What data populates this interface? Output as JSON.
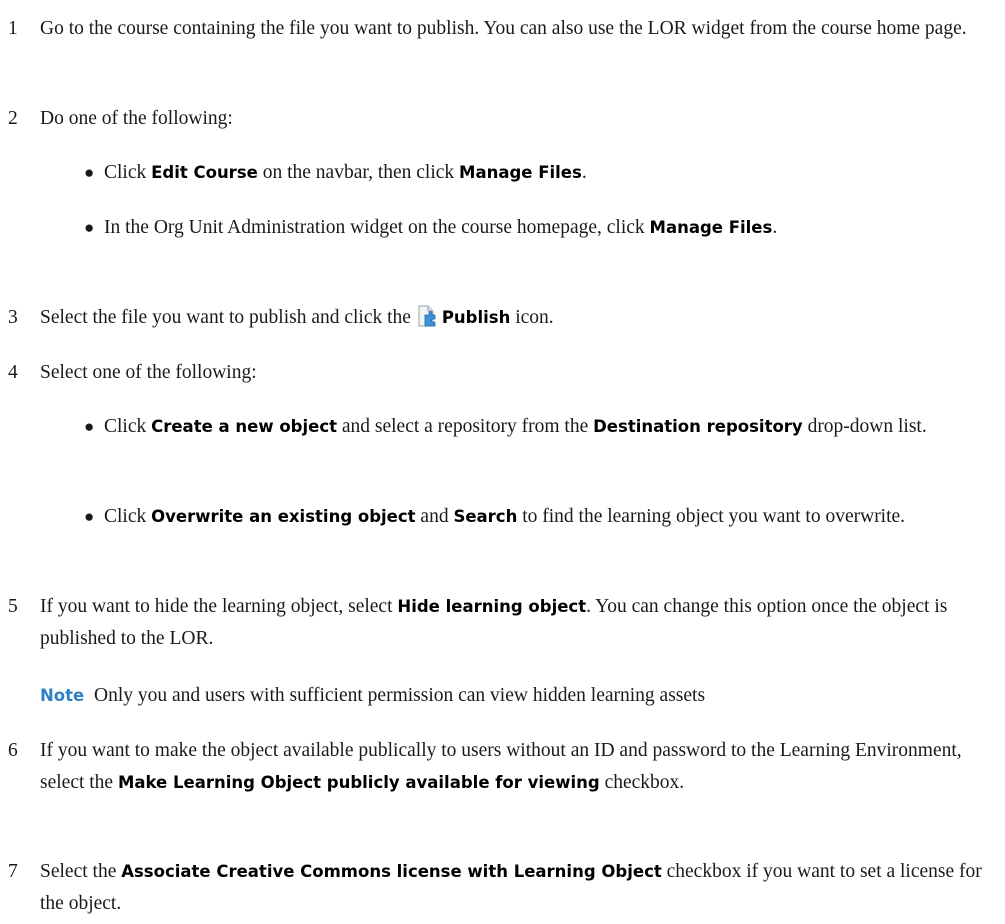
{
  "steps": [
    {
      "num": "1",
      "text": "Go to the course containing the file you want to publish. You can also use the LOR widget from the course home page."
    },
    {
      "num": "2",
      "text": "Do one of the following:",
      "bullets": [
        {
          "pre": "Click ",
          "b1": "Edit Course",
          "mid": " on the navbar, then click ",
          "b2": "Manage Files",
          "post": "."
        },
        {
          "pre": "In the Org Unit Administration widget on the course homepage, click ",
          "b1": "Manage Files",
          "post": "."
        }
      ]
    },
    {
      "num": "3",
      "pre": "Select the file you want to publish and click the ",
      "icon": "publish-icon",
      "bold": "Publish",
      "post": " icon."
    },
    {
      "num": "4",
      "text": "Select one of the following:",
      "bullets": [
        {
          "pre": "Click ",
          "b1": "Create a new object",
          "mid": " and select a repository from the ",
          "b2": "Destination repository",
          "post": " drop-down list."
        },
        {
          "pre": "Click ",
          "b1": "Overwrite an existing object",
          "mid": " and ",
          "b2": "Search",
          "post": " to find the learning object you want to overwrite."
        }
      ]
    },
    {
      "num": "5",
      "pre": "If you want to hide the learning object, select ",
      "bold": "Hide learning object",
      "post": ". You can change this option once the object is published to the LOR.",
      "note_label": "Note",
      "note_text": "Only you and users with sufficient permission can view hidden learning assets"
    },
    {
      "num": "6",
      "pre": "If you want to make the object available publically to users without an ID and password to the Learning Environment, select the ",
      "bold": "Make Learning Object publicly available for viewing",
      "post": " checkbox."
    },
    {
      "num": "7",
      "pre": "Select the ",
      "bold": "Associate Creative Commons license with Learning Object",
      "post": " checkbox if you want to set a license for the object."
    }
  ],
  "colors": {
    "note_accent": "#2f7fc7",
    "text": "#1a1a1a"
  }
}
